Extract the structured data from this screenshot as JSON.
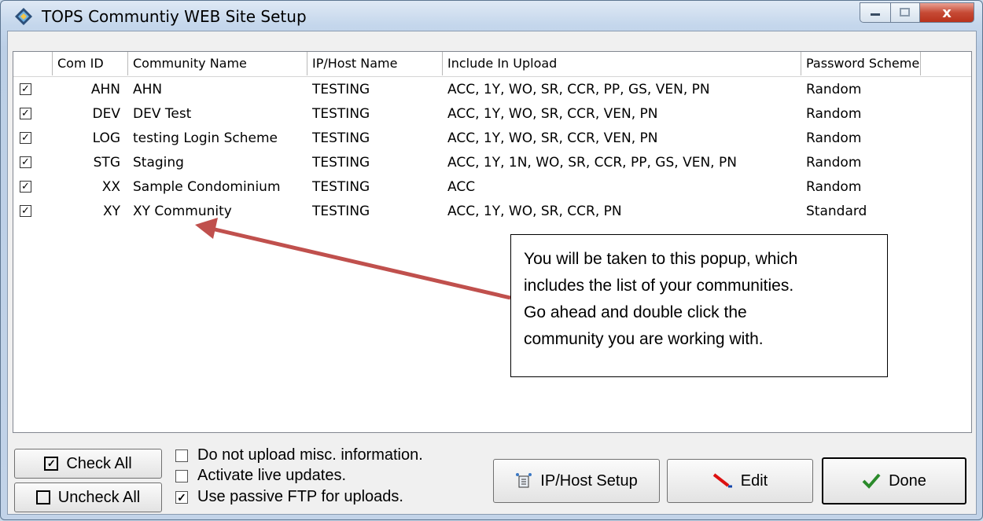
{
  "window": {
    "title": "TOPS Communtiy WEB Site Setup",
    "close_glyph": "x"
  },
  "columns": [
    "",
    "Com ID",
    "Community Name",
    "IP/Host Name",
    "Include In Upload",
    "Password Scheme"
  ],
  "rows": [
    {
      "checked": true,
      "com_id": "AHN",
      "name": "AHN",
      "host": "TESTING",
      "upload": "ACC, 1Y, WO, SR, CCR, PP, GS, VEN, PN",
      "scheme": "Random"
    },
    {
      "checked": true,
      "com_id": "DEV",
      "name": "DEV Test",
      "host": "TESTING",
      "upload": "ACC, 1Y, WO, SR, CCR, VEN, PN",
      "scheme": "Random"
    },
    {
      "checked": true,
      "com_id": "LOG",
      "name": "testing Login Scheme",
      "host": "TESTING",
      "upload": "ACC, 1Y, WO, SR, CCR, VEN, PN",
      "scheme": "Random"
    },
    {
      "checked": true,
      "com_id": "STG",
      "name": "Staging",
      "host": "TESTING",
      "upload": "ACC, 1Y, 1N, WO, SR, CCR, PP, GS, VEN, PN",
      "scheme": "Random"
    },
    {
      "checked": true,
      "com_id": "XX",
      "name": "Sample Condominium",
      "host": "TESTING",
      "upload": "ACC",
      "scheme": "Random"
    },
    {
      "checked": true,
      "com_id": "XY",
      "name": "XY Community",
      "host": "TESTING",
      "upload": "ACC, 1Y, WO, SR, CCR, PN",
      "scheme": "Standard"
    }
  ],
  "callout": {
    "lines": [
      "You will be taken to this popup, which",
      "includes the list of your communities.",
      "Go ahead and double click the",
      "community you are working with."
    ],
    "arrow_color": "#c0504d"
  },
  "buttons": {
    "check_all": "Check All",
    "uncheck_all": "Uncheck All",
    "ip_host_setup": "IP/Host Setup",
    "edit": "Edit",
    "done": "Done"
  },
  "options": [
    {
      "label": "Do not upload misc. information.",
      "checked": false
    },
    {
      "label": "Activate live updates.",
      "checked": false
    },
    {
      "label": "Use passive FTP for uploads.",
      "checked": true
    }
  ],
  "icons": [
    "app-diamond-icon",
    "minimize-icon",
    "maximize-icon",
    "close-icon",
    "network-icon",
    "pencil-icon",
    "checkmark-icon"
  ]
}
